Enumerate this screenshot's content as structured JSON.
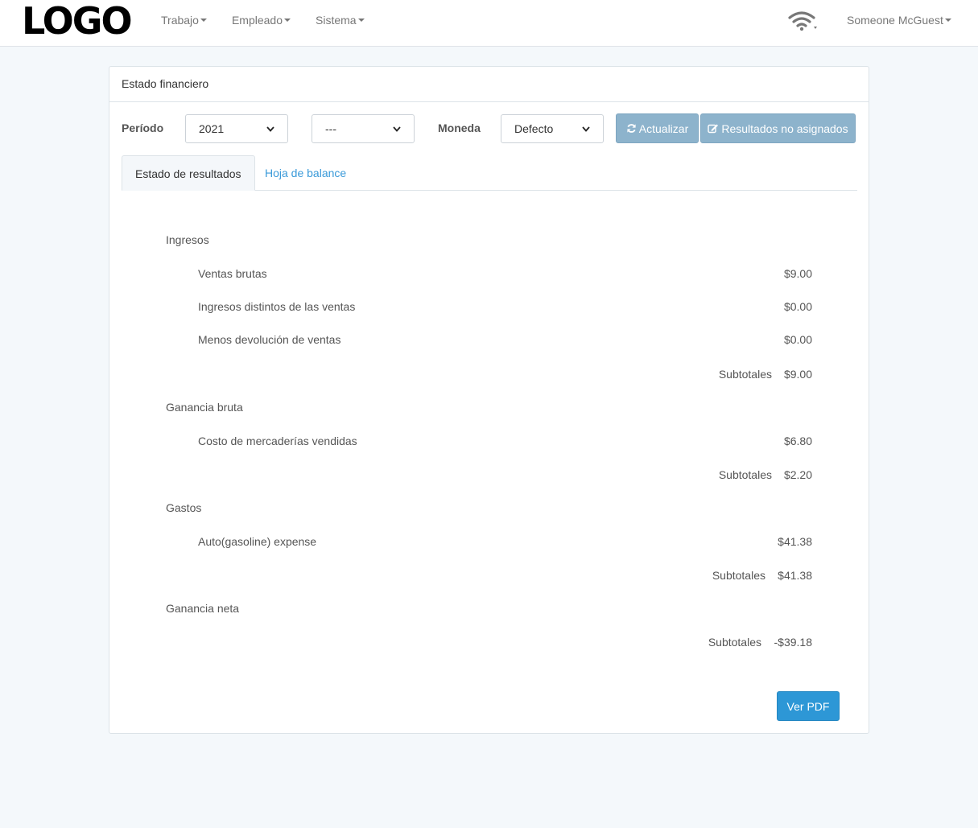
{
  "navbar": {
    "logo": "LOGO",
    "menu": [
      {
        "label": "Trabajo"
      },
      {
        "label": "Empleado"
      },
      {
        "label": "Sistema"
      }
    ],
    "user": "Someone McGuest"
  },
  "panel": {
    "title": "Estado financiero",
    "filters": {
      "period_label": "Período",
      "period_value": "2021",
      "subperiod_value": "---",
      "currency_label": "Moneda",
      "currency_value": "Defecto",
      "refresh_label": "Actualizar",
      "unassigned_label": "Resultados no asignados"
    },
    "tabs": [
      {
        "label": "Estado de resultados"
      },
      {
        "label": "Hoja de balance"
      }
    ],
    "statement": {
      "sections": [
        {
          "title": "Ingresos",
          "items": [
            {
              "label": "Ventas brutas",
              "value": "$9.00"
            },
            {
              "label": "Ingresos distintos de las ventas",
              "value": "$0.00"
            },
            {
              "label": "Menos devolución de ventas",
              "value": "$0.00"
            }
          ],
          "subtotal_label": "Subtotales",
          "subtotal_value": "$9.00"
        },
        {
          "title": "Ganancia bruta",
          "items": [
            {
              "label": "Costo de mercaderías vendidas",
              "value": "$6.80"
            }
          ],
          "subtotal_label": "Subtotales",
          "subtotal_value": "$2.20"
        },
        {
          "title": "Gastos",
          "items": [
            {
              "label": "Auto(gasoline) expense",
              "value": "$41.38"
            }
          ],
          "subtotal_label": "Subtotales",
          "subtotal_value": "$41.38"
        },
        {
          "title": "Ganancia neta",
          "items": [],
          "subtotal_label": "Subtotales",
          "subtotal_value": "-$39.18"
        }
      ]
    },
    "pdf_label": "Ver PDF"
  }
}
